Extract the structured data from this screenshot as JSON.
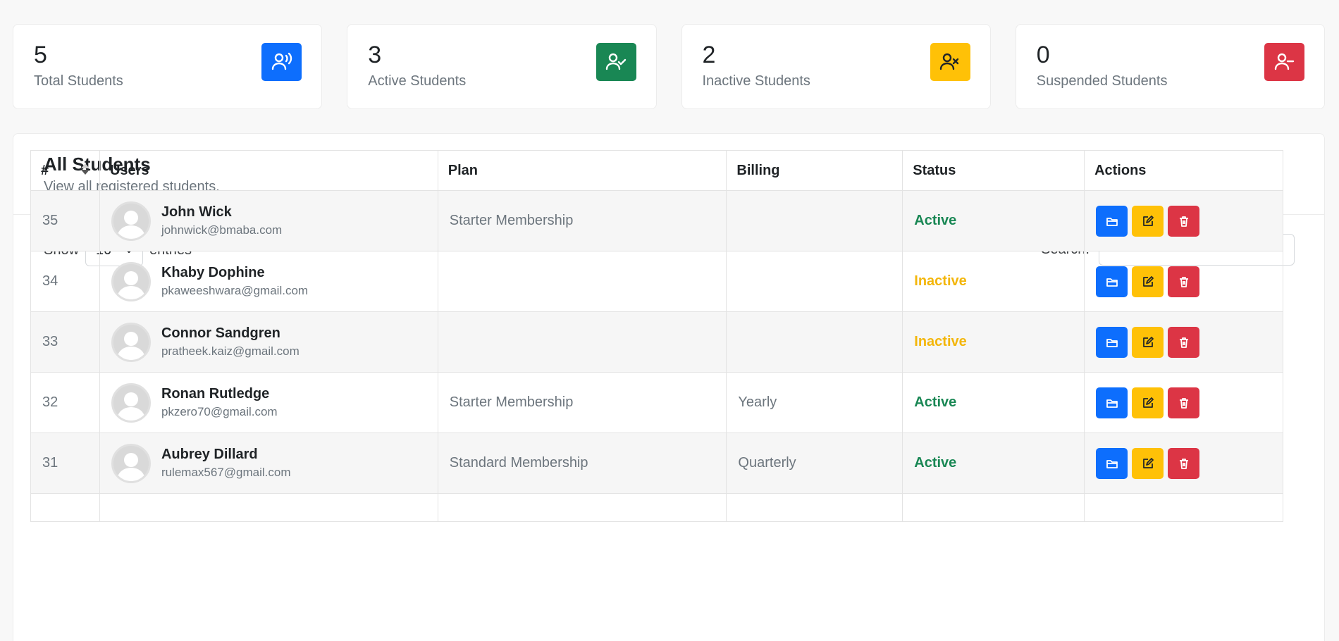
{
  "stats": [
    {
      "value": "5",
      "label": "Total Students",
      "icon": "users-broadcast-icon",
      "color": "#0d6efd"
    },
    {
      "value": "3",
      "label": "Active Students",
      "icon": "user-check-icon",
      "color": "#198754"
    },
    {
      "value": "2",
      "label": "Inactive Students",
      "icon": "user-x-icon",
      "color": "#ffc107"
    },
    {
      "value": "0",
      "label": "Suspended Students",
      "icon": "user-minus-icon",
      "color": "#dc3545"
    }
  ],
  "panel": {
    "title": "All Students",
    "subtitle": "View all registered students."
  },
  "controls": {
    "show_label": "Show",
    "entries_value": "10",
    "entries_label": "entries",
    "search_label": "Search:",
    "search_value": ""
  },
  "table": {
    "headers": [
      "#",
      "Users",
      "Plan",
      "Billing",
      "Status",
      "Actions"
    ],
    "rows": [
      {
        "id": "35",
        "name": "John Wick",
        "email": "johnwick@bmaba.com",
        "plan": "Starter Membership",
        "billing": "",
        "status": "Active"
      },
      {
        "id": "34",
        "name": "Khaby Dophine",
        "email": "pkaweeshwara@gmail.com",
        "plan": "",
        "billing": "",
        "status": "Inactive"
      },
      {
        "id": "33",
        "name": "Connor Sandgren",
        "email": "pratheek.kaiz@gmail.com",
        "plan": "",
        "billing": "",
        "status": "Inactive"
      },
      {
        "id": "32",
        "name": "Ronan Rutledge",
        "email": "pkzero70@gmail.com",
        "plan": "Starter Membership",
        "billing": "Yearly",
        "status": "Active"
      },
      {
        "id": "31",
        "name": "Aubrey Dillard",
        "email": "rulemax567@gmail.com",
        "plan": "Standard Membership",
        "billing": "Quarterly",
        "status": "Active"
      }
    ]
  },
  "colors": {
    "active": "#198754",
    "inactive": "#f3b60b",
    "view_button": "#0d6efd",
    "edit_button": "#ffc107",
    "delete_button": "#dc3545"
  }
}
